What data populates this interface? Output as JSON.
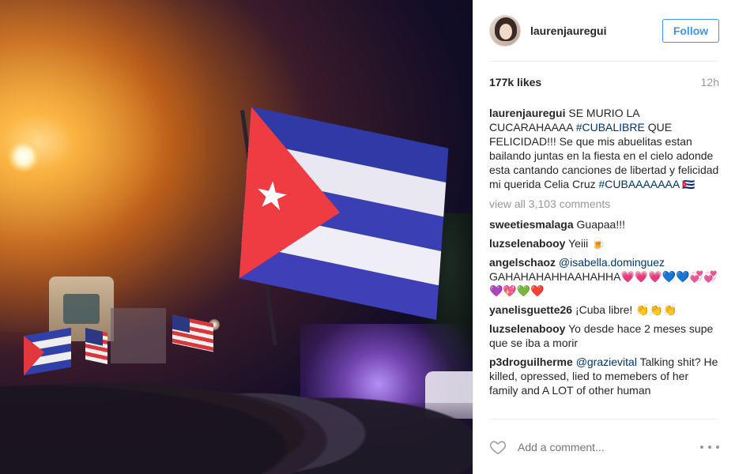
{
  "post": {
    "username": "laurenjauregui",
    "follow_label": "Follow",
    "likes": "177k likes",
    "time": "12h",
    "caption": {
      "user": "laurenjauregui",
      "text_1": "SE MURIO LA CUCARAHAAAA ",
      "tag_1": "#CUBALIBRE",
      "text_2": " QUE FELICIDAD!!! Se que mis abuelitas estan bailando juntas en la fiesta en el cielo adonde esta cantando canciones de libertad y felicidad mi querida Celia Cruz ",
      "tag_2": "#CUBAAAAAAA",
      "emoji": "🇨🇺"
    },
    "view_all": "view all 3,103 comments",
    "comments": [
      {
        "user": "sweetiesmalaga",
        "mention": "",
        "text": "Guapaa!!!"
      },
      {
        "user": "luzselenabooy",
        "mention": "",
        "text": "Yeiii 🍺"
      },
      {
        "user": "angelschaoz",
        "mention": "@isabella.dominguez",
        "text": "GAHAHAHAHHAAHAHHA💗💗💗💙💙💞💞💜💖💚❤️"
      },
      {
        "user": "yanelisguette26",
        "mention": "",
        "text": "¡Cuba libre! 👏👏👏"
      },
      {
        "user": "luzselenabooy",
        "mention": "",
        "text": "Yo desde hace 2 meses supe que se iba a morir"
      },
      {
        "user": "p3droguilherme",
        "mention": "@grazievital",
        "text": "Talking shit? He killed, opressed, lied to memebers of her family and A LOT of other human"
      }
    ],
    "add_comment_placeholder": "Add a comment...",
    "icons": {
      "like": "heart-icon",
      "more": "more-options-icon"
    },
    "colors": {
      "link_blue": "#3897f0",
      "hashtag": "#003569",
      "muted": "#999999"
    }
  }
}
